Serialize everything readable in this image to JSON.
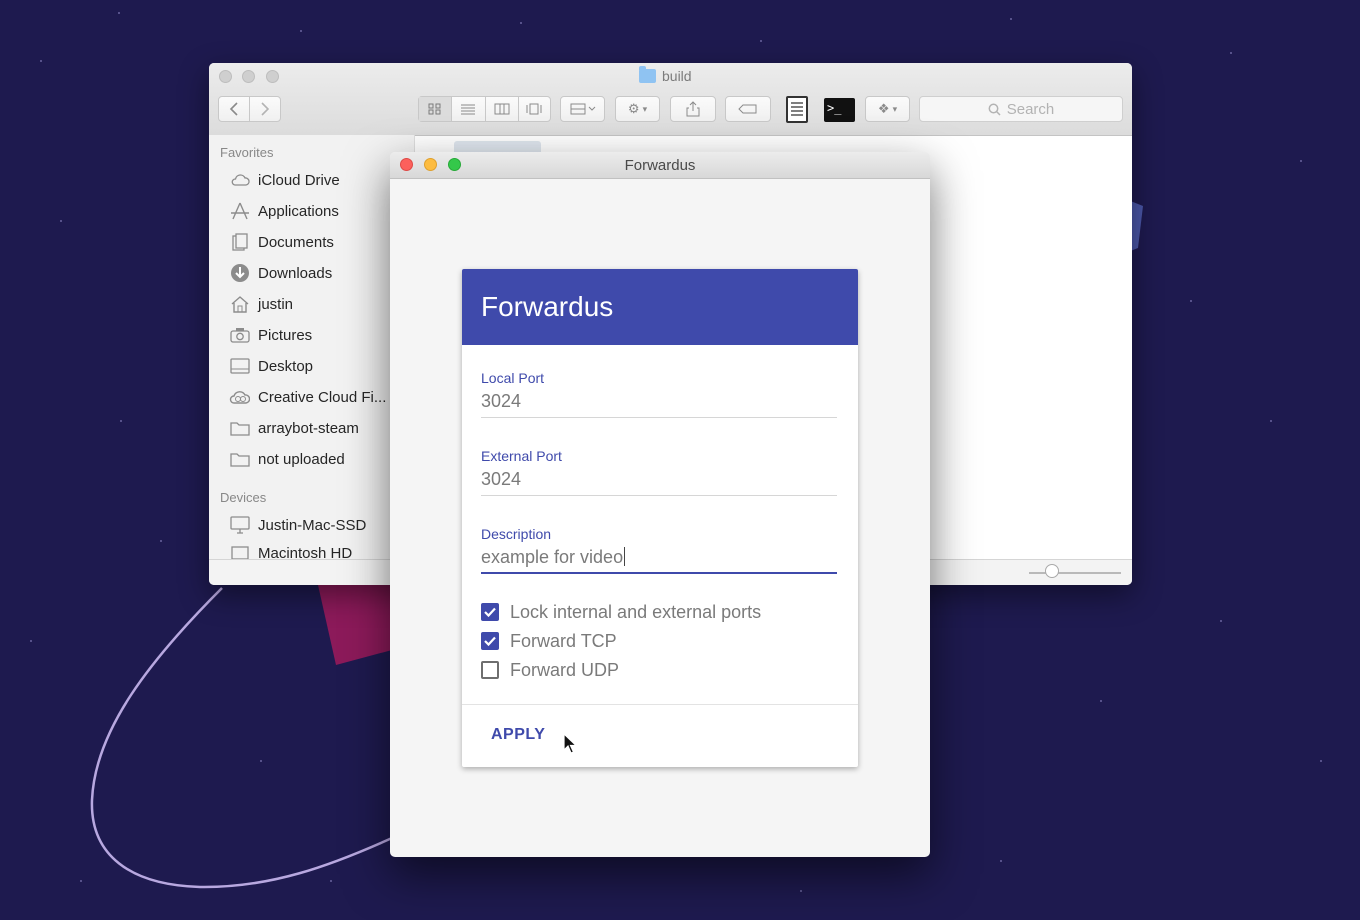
{
  "finder": {
    "title": "build",
    "search_placeholder": "Search",
    "sidebar": {
      "favorites_header": "Favorites",
      "favorites": [
        {
          "label": "iCloud Drive",
          "icon": "cloud-icon"
        },
        {
          "label": "Applications",
          "icon": "applications-icon"
        },
        {
          "label": "Documents",
          "icon": "documents-icon"
        },
        {
          "label": "Downloads",
          "icon": "downloads-icon"
        },
        {
          "label": "justin",
          "icon": "home-icon"
        },
        {
          "label": "Pictures",
          "icon": "camera-icon"
        },
        {
          "label": "Desktop",
          "icon": "desktop-icon"
        },
        {
          "label": "Creative Cloud Fi...",
          "icon": "creative-cloud-icon"
        },
        {
          "label": "arraybot-steam",
          "icon": "folder-icon"
        },
        {
          "label": "not uploaded",
          "icon": "folder-icon"
        }
      ],
      "devices_header": "Devices",
      "devices": [
        {
          "label": "Justin-Mac-SSD",
          "icon": "computer-icon"
        },
        {
          "label": "Macintosh HD",
          "icon": "disk-icon"
        }
      ]
    }
  },
  "forwardus": {
    "window_title": "Forwardus",
    "header_title": "Forwardus",
    "fields": {
      "local_port": {
        "label": "Local Port",
        "value": "3024"
      },
      "external_port": {
        "label": "External Port",
        "value": "3024"
      },
      "description": {
        "label": "Description",
        "value": "example for video"
      }
    },
    "options": [
      {
        "label": "Lock internal and external ports",
        "checked": true
      },
      {
        "label": "Forward TCP",
        "checked": true
      },
      {
        "label": "Forward UDP",
        "checked": false
      }
    ],
    "apply_label": "APPLY",
    "accent_color": "#3f4aab"
  }
}
